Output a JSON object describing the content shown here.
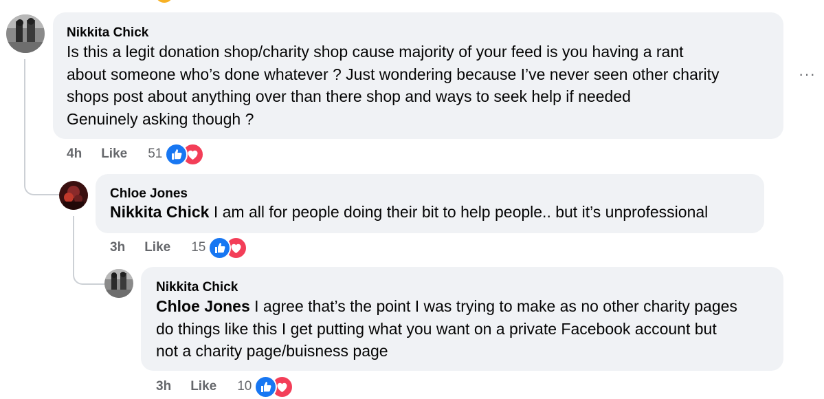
{
  "comments": [
    {
      "author": "Nikkita Chick",
      "mention": "",
      "lines": [
        "Is this a legit donation shop/charity shop cause majority of your feed is you having a rant",
        "about someone who’s done whatever ? Just wondering because I’ve never seen other charity",
        "shops post about anything over than there shop and ways to seek help if needed",
        "Genuinely asking though ?"
      ],
      "time": "4h",
      "like_label": "Like",
      "reaction_count": "51"
    },
    {
      "author": "Chloe Jones",
      "mention": "Nikkita Chick",
      "lines": [
        " I am all for people doing their bit to help people.. but it’s unprofessional"
      ],
      "time": "3h",
      "like_label": "Like",
      "reaction_count": "15"
    },
    {
      "author": "Nikkita Chick",
      "mention": "Chloe Jones",
      "lines": [
        " I agree that’s the point I was trying to make as no other charity pages",
        "do things like this I get putting what you want on a private Facebook account but",
        "not a charity page/buisness page"
      ],
      "time": "3h",
      "like_label": "Like",
      "reaction_count": "10"
    }
  ],
  "more_glyph": "···",
  "icons": {
    "like": "thumbs-up-icon",
    "love": "heart-icon",
    "more": "more-options-icon"
  },
  "colors": {
    "bubble_bg": "#f0f2f5",
    "meta_text": "#65676b",
    "like_blue": "#1877f2",
    "love_red": "#f33e58",
    "thread_line": "#ccd0d5"
  }
}
